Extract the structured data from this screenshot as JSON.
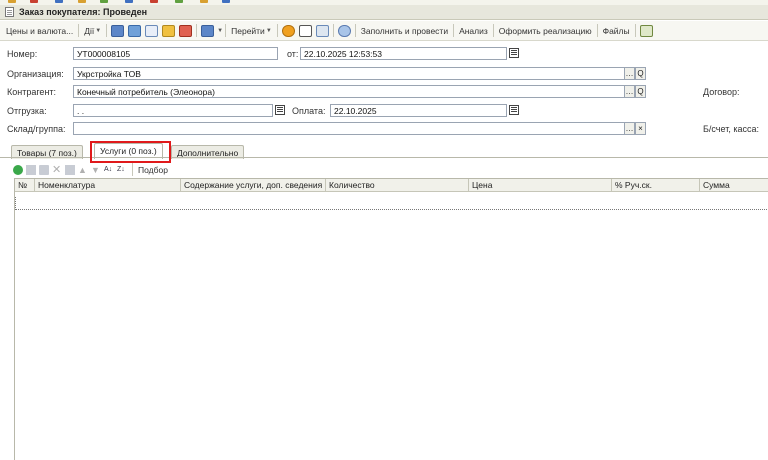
{
  "window": {
    "title": "Заказ покупателя: Проведен"
  },
  "toolbar": {
    "prices_label": "Цены и валюта...",
    "actions_label": "Дії",
    "goto_label": "Перейти",
    "fill_and_post_label": "Заполнить и провести",
    "analysis_label": "Анализ",
    "create_sale_label": "Оформить реализацию",
    "files_label": "Файлы"
  },
  "form": {
    "number_label": "Номер:",
    "number_value": "УТ000008105",
    "date_label": "от:",
    "date_value": "22.10.2025 12:53:53",
    "org_label": "Организация:",
    "org_value": "Укрстройка ТОВ",
    "counterparty_label": "Контрагент:",
    "counterparty_value": "Конечный потребитель (Элеонора)",
    "contract_label": "Договор:",
    "shipment_label": "Отгрузка:",
    "shipment_value": ". .",
    "payment_label": "Оплата:",
    "payment_value": "22.10.2025",
    "warehouse_label": "Склад/группа:",
    "warehouse_value": "",
    "account_label": "Б/счет, касса:"
  },
  "tabs": [
    {
      "label": "Товары (7 поз.)"
    },
    {
      "label": "Услуги (0 поз.)"
    },
    {
      "label": "Дополнительно"
    }
  ],
  "table_toolbar": {
    "pick_label": "Подбор"
  },
  "table": {
    "columns": [
      "№",
      "Номенклатура",
      "Содержание услуги, доп. сведения",
      "Количество",
      "Цена",
      "% Руч.ск.",
      "Сумма"
    ],
    "rows": []
  }
}
